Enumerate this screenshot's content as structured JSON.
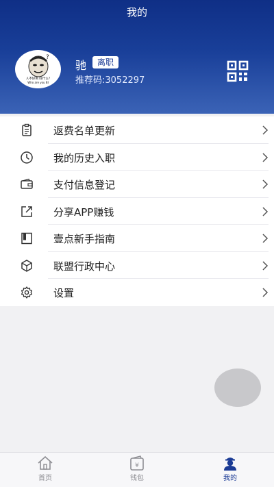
{
  "header": {
    "title": "我的",
    "user_name": "驰",
    "status_badge": "离职",
    "ref_code": "推荐码:3052297",
    "avatar_caption_1": "人不好色 好什么?",
    "avatar_caption_2": "Who are you BI"
  },
  "menu": {
    "items": [
      {
        "label": "返费名单更新",
        "icon": "clipboard-icon"
      },
      {
        "label": "我的历史入职",
        "icon": "clock-icon"
      },
      {
        "label": "支付信息登记",
        "icon": "wallet-icon"
      },
      {
        "label": "分享APP赚钱",
        "icon": "share-icon"
      },
      {
        "label": "壹点新手指南",
        "icon": "book-icon"
      },
      {
        "label": "联盟行政中心",
        "icon": "cube-icon"
      },
      {
        "label": "设置",
        "icon": "gear-icon"
      }
    ]
  },
  "tabbar": {
    "tabs": [
      {
        "label": "首页",
        "icon": "home-icon"
      },
      {
        "label": "钱包",
        "icon": "wallet-tab-icon",
        "glyph": "¥"
      },
      {
        "label": "我的",
        "icon": "profile-icon",
        "active": true
      }
    ]
  },
  "colors": {
    "header_top": "#0f2f86",
    "header_bottom": "#3b63b6",
    "accent": "#1b3b95",
    "background": "#f1f1f3"
  }
}
